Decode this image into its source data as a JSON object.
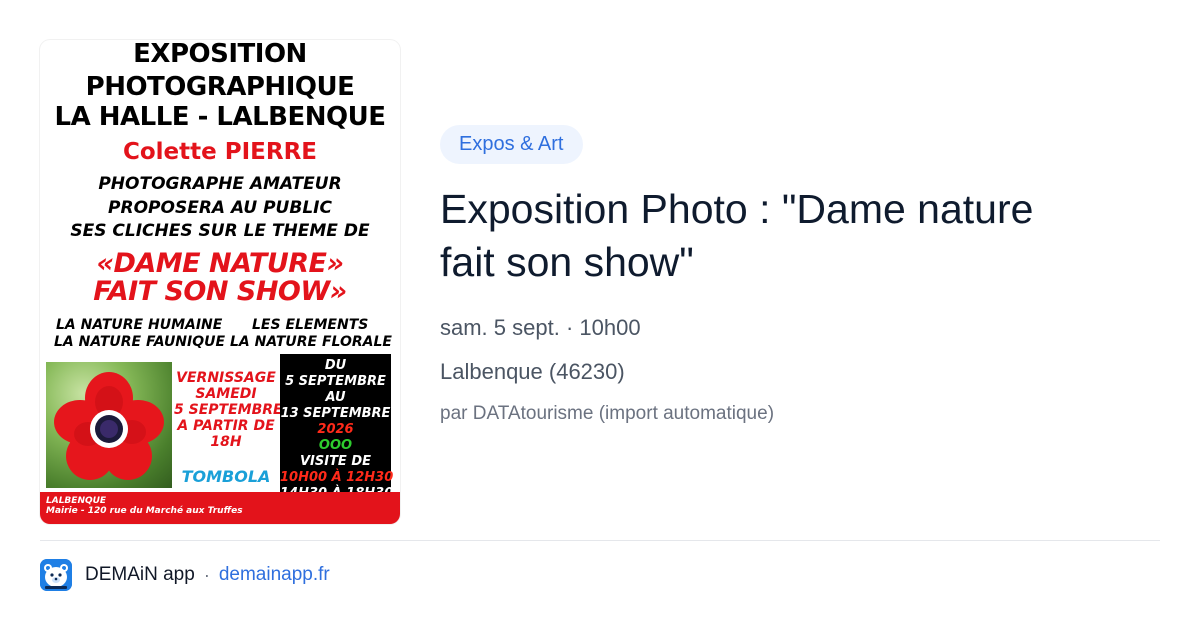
{
  "poster": {
    "title_lines": [
      "EXPOSITION",
      "PHOTOGRAPHIQUE",
      "LA HALLE - LALBENQUE"
    ],
    "artist": "Colette PIERRE",
    "description_lines": [
      "PHOTOGRAPHE AMATEUR",
      "PROPOSERA AU PUBLIC",
      "SES CLICHES SUR LE THEME DE"
    ],
    "theme_lines": [
      "«DAME NATURE»",
      "FAIT SON SHOW»"
    ],
    "categories": [
      "LA NATURE HUMAINE",
      "LA NATURE FAUNIQUE",
      "LES ELEMENTS",
      "LA NATURE FLORALE"
    ],
    "vernissage_lines": [
      "VERNISSAGE",
      "SAMEDI",
      "5 SEPTEMBRE",
      "A PARTIR DE",
      "18H"
    ],
    "tombola": "TOMBOLA",
    "dates_block": {
      "du": "DU",
      "start": "5 SEPTEMBRE",
      "au": "AU",
      "end": "13 SEPTEMBRE",
      "year": "2026",
      "sep": "oOo",
      "visite": "VISITE DE",
      "slot1": "10H00 à 12h30",
      "slot2": "14h30 à 18h30"
    },
    "address_line1": "LALBENQUE",
    "address_line2": "Mairie - 120 rue du Marché aux Truffes"
  },
  "event": {
    "category": "Expos & Art",
    "title_lines": [
      "Exposition Photo : \"Dame nature",
      "fait son show\""
    ],
    "datetime": "sam. 5 sept. · 10h00",
    "location": "Lalbenque (46230)",
    "source": "par DATAtourisme (import automatique)"
  },
  "footer": {
    "app_name": "DEMAiN app",
    "separator": "·",
    "domain": "demainapp.fr",
    "icon": "bear-logo-icon"
  },
  "colors": {
    "accent": "#2f6fde",
    "chip_bg": "#eef4fe",
    "poster_red": "#e3131b",
    "poster_blue": "#1aa0d8"
  }
}
